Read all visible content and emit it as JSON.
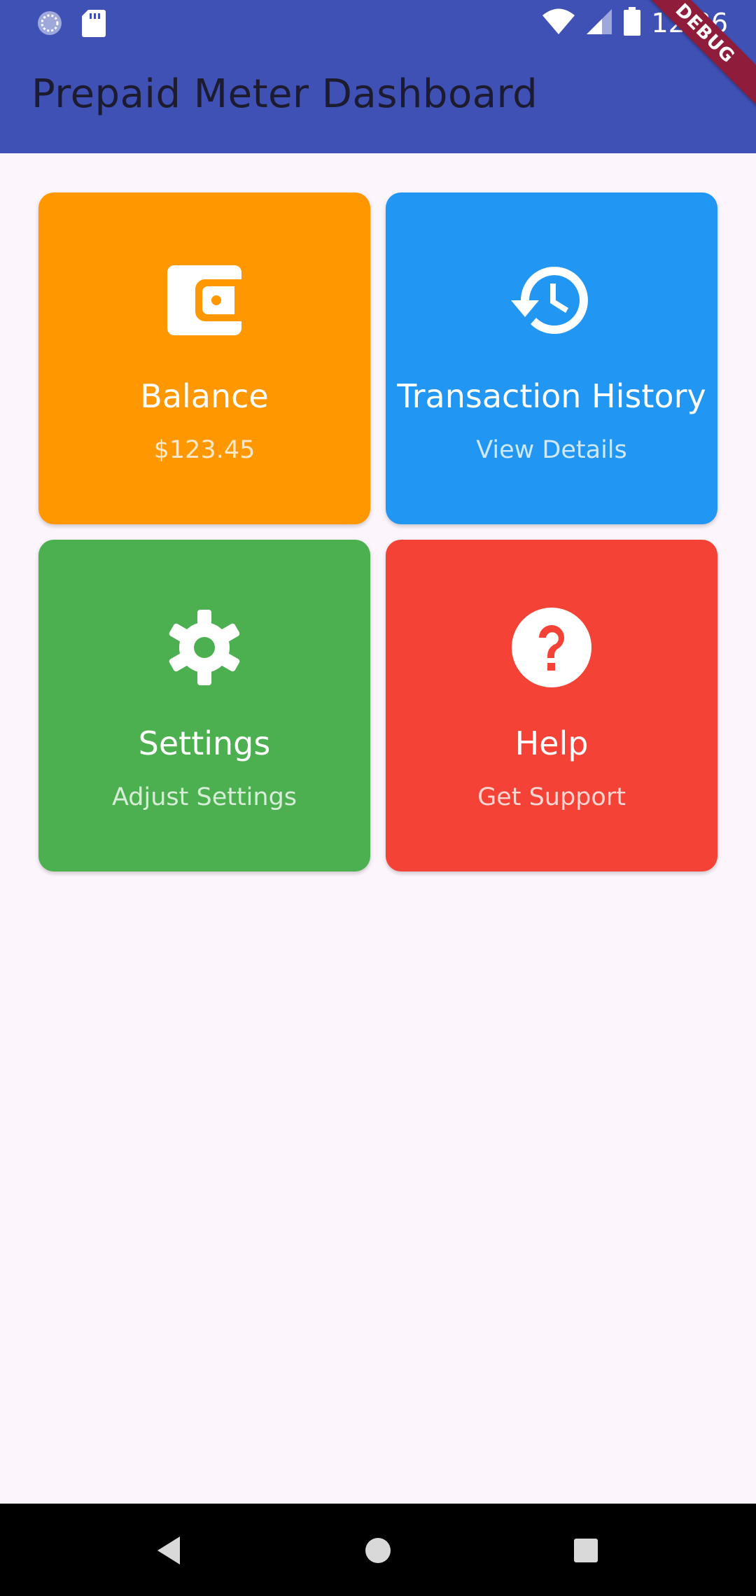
{
  "status_bar": {
    "time": "12:36",
    "icons": [
      "sync-icon",
      "sd-card-icon",
      "wifi-icon",
      "signal-icon",
      "battery-icon"
    ]
  },
  "app_bar": {
    "title": "Prepaid Meter Dashboard",
    "color": "#3f51b5"
  },
  "debug_banner": {
    "label": "DEBUG"
  },
  "cards": [
    {
      "title": "Balance",
      "subtitle": "$123.45",
      "icon": "wallet-icon",
      "color": "#ff9800"
    },
    {
      "title": "Transaction History",
      "subtitle": "View Details",
      "icon": "history-icon",
      "color": "#2196f3"
    },
    {
      "title": "Settings",
      "subtitle": "Adjust Settings",
      "icon": "gear-icon",
      "color": "#4caf50"
    },
    {
      "title": "Help",
      "subtitle": "Get Support",
      "icon": "help-icon",
      "color": "#f44336"
    }
  ],
  "nav_bar": {
    "buttons": [
      "back-icon",
      "home-icon",
      "recents-icon"
    ]
  }
}
